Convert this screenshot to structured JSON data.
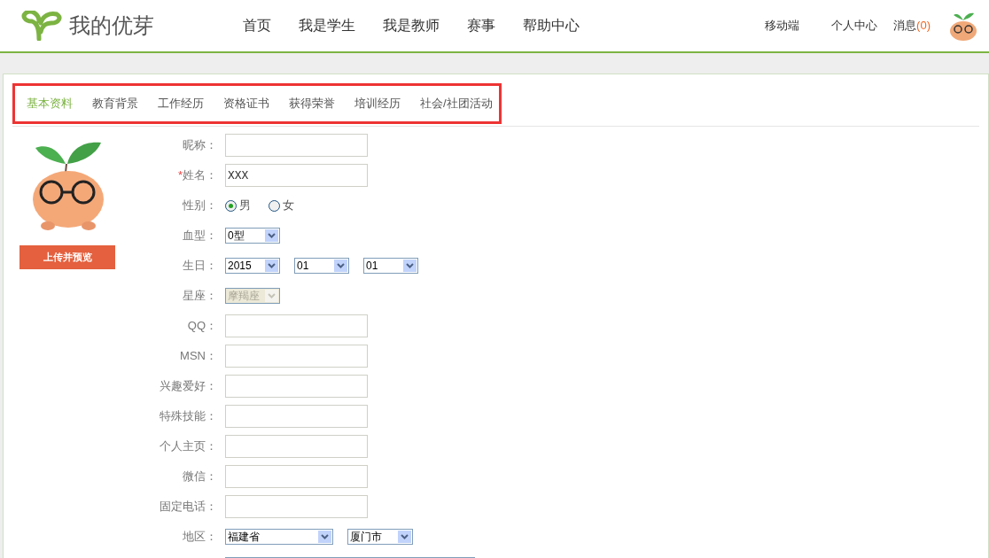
{
  "header": {
    "logo_text": "我的优芽",
    "nav": [
      {
        "label": "首页"
      },
      {
        "label": "我是学生"
      },
      {
        "label": "我是教师"
      },
      {
        "label": "赛事"
      },
      {
        "label": "帮助中心"
      }
    ],
    "links": [
      {
        "label": "移动端"
      },
      {
        "label": "个人中心"
      }
    ],
    "messages": {
      "label": "消息",
      "count": "(0)"
    }
  },
  "tabs": [
    {
      "label": "基本资料",
      "selected": true
    },
    {
      "label": "教育背景",
      "selected": false
    },
    {
      "label": "工作经历",
      "selected": false
    },
    {
      "label": "资格证书",
      "selected": false
    },
    {
      "label": "获得荣誉",
      "selected": false
    },
    {
      "label": "培训经历",
      "selected": false
    },
    {
      "label": "社会/社团活动",
      "selected": false
    }
  ],
  "avatar": {
    "upload_button": "上传并预览"
  },
  "form": [
    {
      "kind": "text",
      "label": "昵称："
    },
    {
      "kind": "text",
      "label": "姓名：",
      "required_mark": "*",
      "value": "XXX"
    },
    {
      "kind": "radio",
      "label": "性别：",
      "options": [
        {
          "label": "男",
          "selected": true
        },
        {
          "label": "女",
          "selected": false
        }
      ]
    },
    {
      "kind": "select",
      "label": "血型：",
      "selects": [
        {
          "value": "0型",
          "disabled": false
        }
      ]
    },
    {
      "kind": "select",
      "label": "生日：",
      "selects": [
        {
          "value": "2015",
          "disabled": false
        },
        {
          "value": "01",
          "disabled": false
        },
        {
          "value": "01",
          "disabled": false
        }
      ]
    },
    {
      "kind": "select",
      "label": "星座：",
      "selects": [
        {
          "value": "摩羯座",
          "disabled": true
        }
      ]
    },
    {
      "kind": "text",
      "label": "QQ："
    },
    {
      "kind": "text",
      "label": "MSN："
    },
    {
      "kind": "text",
      "label": "兴趣爱好："
    },
    {
      "kind": "text",
      "label": "特殊技能："
    },
    {
      "kind": "text",
      "label": "个人主页："
    },
    {
      "kind": "text",
      "label": "微信："
    },
    {
      "kind": "text",
      "label": "固定电话："
    },
    {
      "kind": "select",
      "label": "地区：",
      "selects": [
        {
          "value": "福建省",
          "disabled": false
        },
        {
          "value": "厦门市",
          "disabled": false
        }
      ]
    }
  ]
}
